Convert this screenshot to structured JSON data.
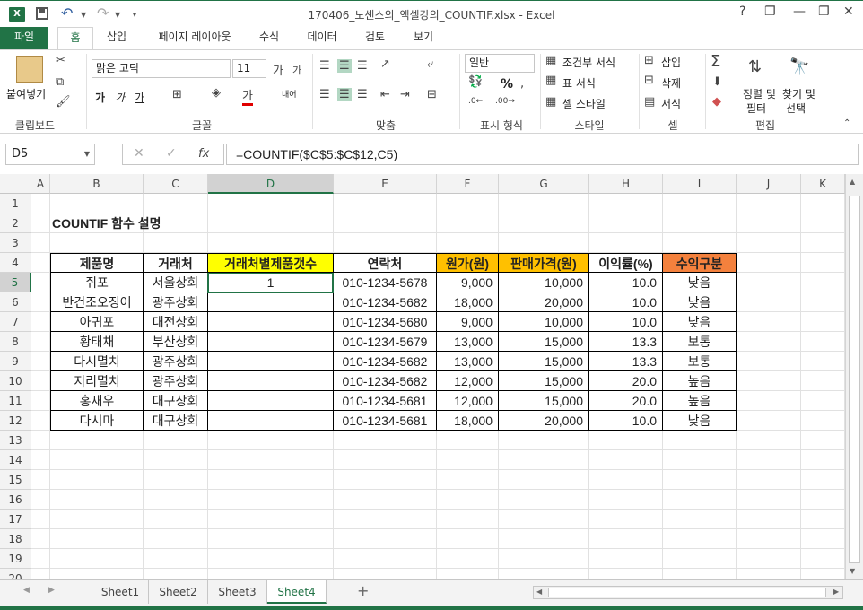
{
  "window": {
    "title": "170406_노센스의_엑셀강의_COUNTIF.xlsx - Excel",
    "app_icon": "X",
    "help": "?",
    "minimize": "—",
    "restore": "❐",
    "close": "✕"
  },
  "ribbon_tabs": [
    "파일",
    "홈",
    "삽입",
    "페이지 레이아웃",
    "수식",
    "데이터",
    "검토",
    "보기"
  ],
  "active_tab": "홈",
  "ribbon": {
    "clipboard": {
      "paste": "붙여넣기",
      "label": "클립보드"
    },
    "font": {
      "name": "맑은 고딕",
      "size": "11",
      "label": "글꼴",
      "bold": "가",
      "italic": "가",
      "underline": "가"
    },
    "alignment": {
      "label": "맞춤",
      "wrap": "내어"
    },
    "number": {
      "format": "일반",
      "label": "표시 형식",
      "percent": "%"
    },
    "styles": {
      "conditional": "조건부 서식",
      "table": "표 서식",
      "cell": "셀 스타일",
      "label": "스타일"
    },
    "cells": {
      "insert": "삽입",
      "delete": "삭제",
      "format": "서식",
      "label": "셀"
    },
    "editing": {
      "sort": "정렬 및",
      "sort2": "필터",
      "find": "찾기 및",
      "find2": "선택",
      "label": "편집"
    }
  },
  "formula_bar": {
    "name_box": "D5",
    "formula": "=COUNTIF($C$5:$C$12,C5)",
    "cancel": "✕",
    "enter": "✓",
    "fx": "fx"
  },
  "columns": [
    "A",
    "B",
    "C",
    "D",
    "E",
    "F",
    "G",
    "H",
    "I",
    "J",
    "K"
  ],
  "rows": [
    "1",
    "2",
    "3",
    "4",
    "5",
    "6",
    "7",
    "8",
    "9",
    "10",
    "11",
    "12",
    "13",
    "14",
    "15",
    "16",
    "17",
    "18",
    "19",
    "20"
  ],
  "sheet": {
    "title": "COUNTIF 함수 설명",
    "headers": [
      "제품명",
      "거래처",
      "거래처별제품갯수",
      "연락처",
      "원가(원)",
      "판매가격(원)",
      "이익률(%)",
      "수익구분"
    ],
    "header_colors": [
      "#ffffff",
      "#ffffff",
      "#ffff00",
      "#ffffff",
      "#ffc000",
      "#ffc000",
      "#ffffff",
      "#f4813d"
    ],
    "data": [
      [
        "쥐포",
        "서울상회",
        "1",
        "010-1234-5678",
        "9,000",
        "10,000",
        "10.0",
        "낮음"
      ],
      [
        "반건조오징어",
        "광주상회",
        "",
        "010-1234-5682",
        "18,000",
        "20,000",
        "10.0",
        "낮음"
      ],
      [
        "아귀포",
        "대전상회",
        "",
        "010-1234-5680",
        "9,000",
        "10,000",
        "10.0",
        "낮음"
      ],
      [
        "황태채",
        "부산상회",
        "",
        "010-1234-5679",
        "13,000",
        "15,000",
        "13.3",
        "보통"
      ],
      [
        "다시멸치",
        "광주상회",
        "",
        "010-1234-5682",
        "13,000",
        "15,000",
        "13.3",
        "보통"
      ],
      [
        "지리멸치",
        "광주상회",
        "",
        "010-1234-5682",
        "12,000",
        "15,000",
        "20.0",
        "높음"
      ],
      [
        "홍새우",
        "대구상회",
        "",
        "010-1234-5681",
        "12,000",
        "15,000",
        "20.0",
        "높음"
      ],
      [
        "다시마",
        "대구상회",
        "",
        "010-1234-5681",
        "18,000",
        "20,000",
        "10.0",
        "낮음"
      ]
    ]
  },
  "sheet_tabs": [
    "Sheet1",
    "Sheet2",
    "Sheet3",
    "Sheet4"
  ],
  "active_sheet": "Sheet4",
  "add_sheet": "+"
}
